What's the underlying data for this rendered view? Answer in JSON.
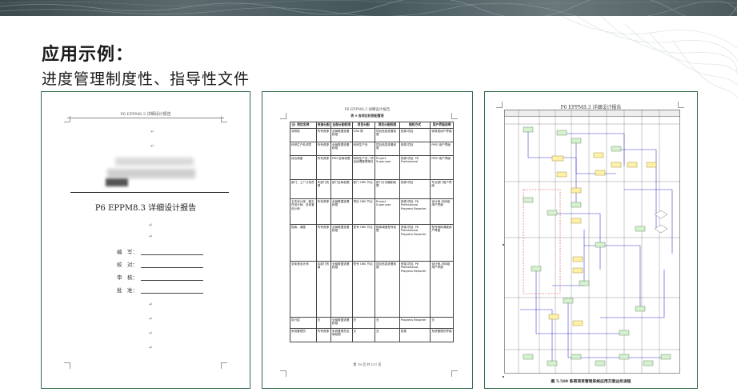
{
  "slide": {
    "title": "应用示例：",
    "subtitle": "进度管理制度性、指导性文件"
  },
  "doc1": {
    "header": "P6 EPPM8.3 详细设计报告",
    "report_title": "P6 EPPM8.3 详细设计报告",
    "signature_fields": [
      {
        "label": "编　写："
      },
      {
        "label": "校　对："
      },
      {
        "label": "审　核："
      },
      {
        "label": "批　准："
      }
    ]
  },
  "doc2": {
    "header": "P6 EPPM8.3 详细设计报告",
    "caption": "表 9 各岗位权限配置表",
    "columns": [
      "岗位名称",
      "资源分配",
      "全局分配权限",
      "项目分配",
      "项目分配权限",
      "授权方式",
      "用户界面说明"
    ],
    "rows": [
      [
        "领导层",
        "所有资源",
        "全局数据查看权限",
        "OBS 根",
        "项目信息查看权限",
        "资源-项目",
        "领导层用户界面"
      ],
      [
        "科研生产处领导",
        "所有资源",
        "全局数据查看权限",
        "科研生产处",
        "项目信息查看权限",
        "资源-项目",
        "PMO 用户界面"
      ],
      [
        "综合调度",
        "所有资源",
        "PMO全局权限",
        "科研生产处 / 项目经理管理单位",
        "Project Superuser",
        "资源-项目, P6 Professional",
        "PMO 用户界面"
      ],
      [
        "部门、工厂计划员",
        "本部门资源",
        "部门全局权限",
        "部门 OBS 节点",
        "部门计划编制权限",
        "资源-项目",
        "专业部门用户界面"
      ],
      [
        "主任设计师、副主任设计师、总体室设计师",
        "所有资源",
        "全局数据查看权限",
        "项目 OBS 节点",
        "Project Superuser",
        "资源-项目, P6 Professional, Progress Reporter",
        "设计师-总体组用户界面"
      ],
      [
        "指挥、调度",
        "所有资源",
        "全局数据查看权限",
        "型号 OBS 节点",
        "指挥调度型号权限",
        "资源-项目, P6 Professional, Progress Reporter",
        "型号指挥调度用户界面"
      ],
      [
        "总体室设计师",
        "本部门资源",
        "全局数据查看权限",
        "型号 OBS 节点",
        "项目信息查看权限",
        "资源-项目, P6 Professional, Progress Reporter",
        "设计师-总体组用户界面"
      ],
      [
        "执行层",
        "无",
        "全局数据查看权限",
        "无",
        "无",
        "Progress Reporter",
        "无"
      ],
      [
        "系统管理员",
        "所有资源",
        "系统管理员全局权限",
        "无",
        "无",
        "资源",
        "系统管理员界面"
      ]
    ],
    "footer": "第 78 页 共 137 页"
  },
  "doc3": {
    "header": "P6 EPPM8.3 详细设计报告",
    "caption": "图 5.508 陈哥项目管理系统应用方案业务流程"
  },
  "colors": {
    "frame_border": "#2f6b4a",
    "flow_box": "#d6f0d0",
    "flow_box_alt": "#fff2a8",
    "flow_line": "#3b3bd0",
    "flow_dash": "#d84040"
  }
}
